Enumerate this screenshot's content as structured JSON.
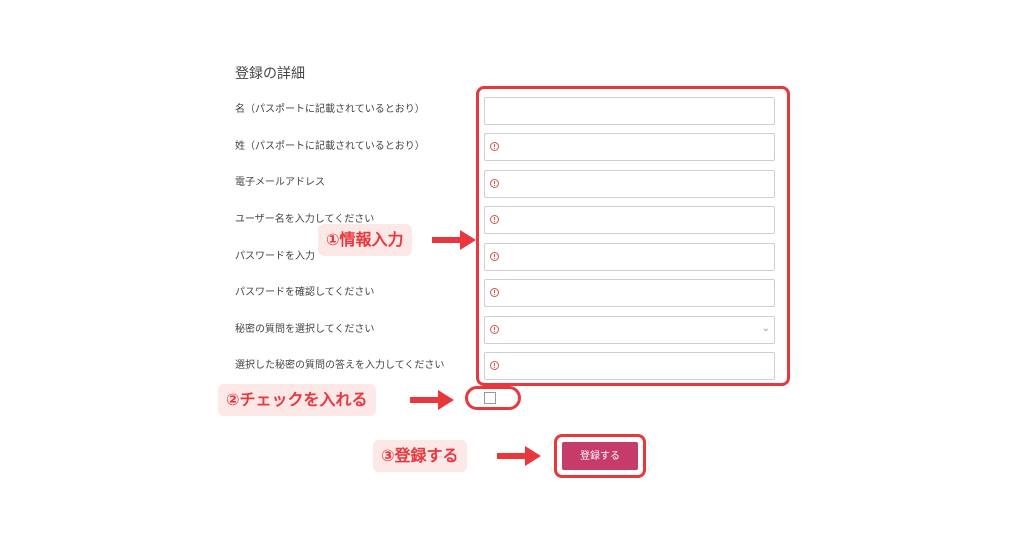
{
  "form": {
    "title": "登録の詳細",
    "fields": [
      {
        "label": "名（パスポートに記載されているとおり）",
        "value": ""
      },
      {
        "label": "姓（パスポートに記載されているとおり）",
        "value": ""
      },
      {
        "label": "電子メールアドレス",
        "value": ""
      },
      {
        "label": "ユーザー名を入力してください",
        "value": ""
      },
      {
        "label": "パスワードを入力",
        "value": ""
      },
      {
        "label": "パスワードを確認してください",
        "value": ""
      },
      {
        "label": "秘密の質問を選択してください",
        "value": ""
      },
      {
        "label": "選択した秘密の質問の答えを入力してください",
        "value": ""
      }
    ],
    "submit_label": "登録する"
  },
  "annotations": {
    "step1": "①情報入力",
    "step2": "②チェックを入れる",
    "step3": "③登録する"
  },
  "colors": {
    "annotation_red": "#e8383d",
    "annotation_bg": "#fde8e8",
    "submit_button": "#c63b6a",
    "warning_icon": "#d9534f"
  }
}
